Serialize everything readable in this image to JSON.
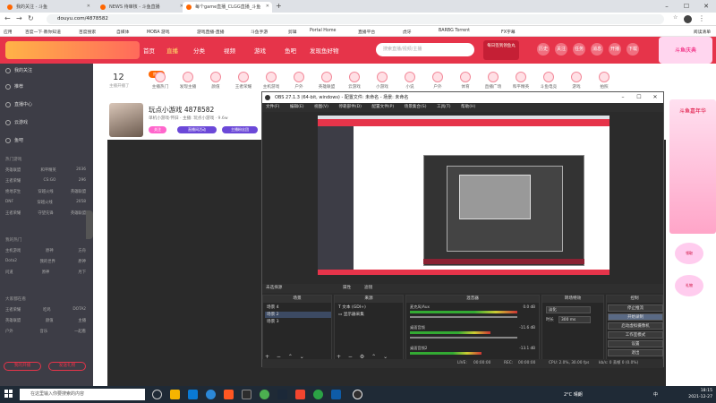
{
  "browser": {
    "tabs": [
      {
        "label": "我的关注 - 斗鱼"
      },
      {
        "label": "NEWS 待审核 - 斗鱼直播"
      },
      {
        "label": "每个game直播_CLGG直播_斗鱼"
      }
    ],
    "url": "douyu.com/4878582",
    "bookmarks": [
      "应用",
      "百度一下·教你知道",
      "百度搜索",
      "自媒体",
      "MOBA 游戏",
      "游戏直播-直播",
      "斗鱼手游",
      "剪辑",
      "Portal Home",
      "直播平台",
      "虎牙",
      "BARBG Torrent",
      "FX字幕"
    ],
    "reading_list": "阅读清单"
  },
  "site": {
    "nav": [
      "首页",
      "直播",
      "分类",
      "视频",
      "游戏",
      "鱼吧",
      "发现鱼好物"
    ],
    "active_nav": "直播",
    "search_placeholder": "搜索直播/视频/主播",
    "banner_text": "每日签到领鱼丸",
    "header_ad": "斗鱼庆典",
    "header_icons": [
      "历史",
      "关注",
      "任务",
      "消息",
      "开播",
      "下载"
    ]
  },
  "sidebar": {
    "items": [
      "我的关注",
      "推荐",
      "直播中心",
      "云游戏",
      "鱼吧"
    ],
    "section1": "热门游戏",
    "grid1": [
      [
        "英雄联盟",
        "和平精英",
        "2036"
      ],
      [
        "王者荣耀",
        "CS:GO",
        "296"
      ],
      [
        "绝地求生",
        "穿越火线",
        "英雄联盟"
      ],
      [
        "DNF",
        "穿越火线",
        "2058"
      ],
      [
        "王者荣耀",
        "守望先锋",
        "英雄联盟"
      ]
    ],
    "section2": "我的热门",
    "grid2": [
      [
        "主机游戏",
        "原神",
        "方舟"
      ],
      [
        "Dota2",
        "我的世界",
        "原神"
      ],
      [
        "问道",
        "原神",
        "月下"
      ]
    ],
    "section3": "大家都在看",
    "grid3": [
      [
        "王者荣耀",
        "吃鸡",
        "DOTA2"
      ],
      [
        "英雄联盟",
        "颜值",
        "主播"
      ],
      [
        "户外",
        "音乐",
        "一起看"
      ]
    ],
    "btn_left": "我的开播",
    "btn_right": "发送礼物"
  },
  "room": {
    "day_count": "12",
    "day_label": "主播开播了",
    "hot_badge": "热门",
    "categories": [
      "主播热门",
      "发现主播",
      "颜值",
      "王者荣耀",
      "主机游戏",
      "户外",
      "英雄联盟",
      "云游戏",
      "小游戏",
      "小说",
      "户外",
      "体育",
      "直播广场",
      "和平精英",
      "斗鱼电竞",
      "游戏",
      "拍照"
    ],
    "title": "玩点小游戏 4878582",
    "subtitle": "单机小游戏·怀旧 · 主播: 玩点小游戏 · 9.6w",
    "follow_label": "关注",
    "btn1": "直播间活动",
    "btn2": "主播粉丝团"
  },
  "right_ad": {
    "text": "斗鱼嘉年华",
    "btn1": "领取",
    "btn2": "礼物"
  },
  "obs": {
    "title": "OBS 27.1.3 (64-bit, windows) - 配置文件: 未命名 - 场景: 未命名",
    "menu": [
      "文件(F)",
      "编辑(E)",
      "视图(V)",
      "停靠部件(D)",
      "配置文件(P)",
      "场景集合(S)",
      "工具(T)",
      "帮助(H)"
    ],
    "source_bar": [
      "未选择源",
      "属性",
      "滤镜"
    ],
    "docks": {
      "scenes": {
        "title": "场景",
        "items": [
          "场景 4",
          "场景 2",
          "场景 3"
        ],
        "selected": 1
      },
      "sources": {
        "title": "来源",
        "items": [
          "文本 (GDI+)",
          "显示器采集"
        ]
      },
      "mixer": {
        "title": "混音器",
        "channels": [
          {
            "name": "麦克风/Aux",
            "value": "0.0 dB"
          },
          {
            "name": "桌面音频",
            "value": "-11.6 dB"
          },
          {
            "name": "桌面音频2",
            "value": "-13.1 dB"
          }
        ]
      },
      "transitions": {
        "title": "转场特效",
        "type": "淡化",
        "duration_label": "时长",
        "duration": "300 ms"
      },
      "controls": {
        "title": "控制",
        "buttons": [
          "停止推流",
          "开始录制",
          "启动虚拟摄像机",
          "工作室模式",
          "设置",
          "退出"
        ],
        "highlighted": 1
      }
    },
    "status": {
      "live_label": "LIVE:",
      "live_time": "00:00:00",
      "rec_label": "REC:",
      "rec_time": "00:00:00",
      "cpu": "CPU: 2.0%, 30.00 fps",
      "kbps": "kb/s: 0 丢帧 0 (0.0%)"
    }
  },
  "taskbar": {
    "search_placeholder": "在这里输入你要搜索的内容",
    "weather": "2°C 晴朗",
    "time": "18:15",
    "date": "2021-12-27",
    "lang": "中"
  },
  "colors": {
    "brand": "#e6344a",
    "sidebar": "#3d3d46",
    "obs_bg": "#2b2b2b"
  }
}
